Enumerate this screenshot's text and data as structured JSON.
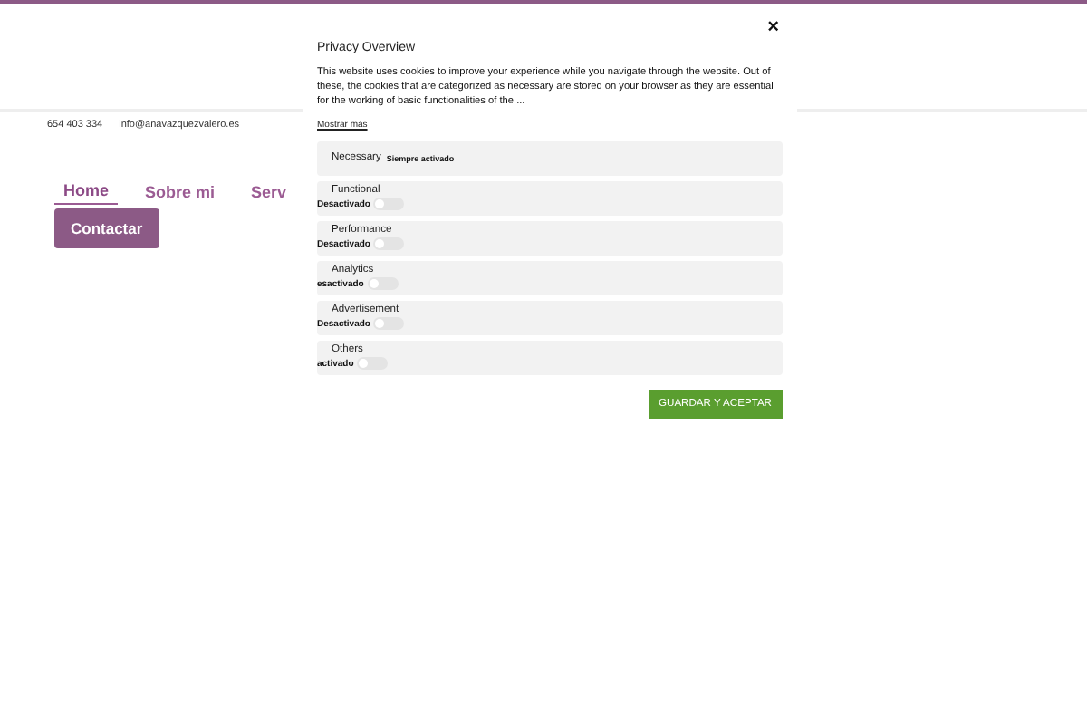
{
  "contact": {
    "phone": "654 403 334",
    "email": "info@anavazquezvalero.es"
  },
  "nav": [
    {
      "label": "Home",
      "selected": true
    },
    {
      "label": "Sobre mi",
      "selected": false
    },
    {
      "label": "Serv",
      "selected": false
    }
  ],
  "cta": "Contactar",
  "modal": {
    "close": "×",
    "title": "Privacy Overview",
    "text": "This website uses cookies to improve your experience while you navigate through the website. Out of these, the cookies that are categorized as necessary are stored on your browser as they are essential for the working of basic functionalities of the ...",
    "more": "Mostrar más",
    "categories": [
      {
        "kind": "always",
        "name": "Necessary",
        "status": "Siempre activado"
      },
      {
        "kind": "toggle",
        "name": "Functional",
        "status": "Desactivado",
        "checked": false
      },
      {
        "kind": "toggle",
        "name": "Performance",
        "status": "Desactivado",
        "checked": false
      },
      {
        "kind": "toggle",
        "name": "Analytics",
        "status": "esactivado",
        "checked": false
      },
      {
        "kind": "toggle",
        "name": "Advertisement",
        "status": "Desactivado",
        "checked": false
      },
      {
        "kind": "toggle",
        "name": "Others",
        "status": "activado",
        "checked": false
      }
    ],
    "save": "GUARDAR Y ACEPTAR"
  }
}
